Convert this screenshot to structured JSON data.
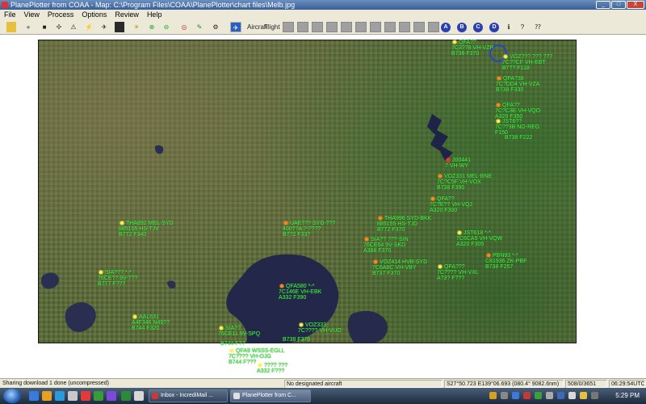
{
  "window": {
    "title": "PlanePlotter from COAA - Map: C:\\Program Files\\COAA\\PlanePlotter\\chart files\\Melb.jpg",
    "minimize": "_",
    "maximize": "□",
    "close": "X"
  },
  "menu": [
    "File",
    "View",
    "Process",
    "Options",
    "Review",
    "Help"
  ],
  "toolbar": {
    "aircraft_label": "Aircraft",
    "flight_label": "Flight",
    "letters": [
      "A",
      "B",
      "C",
      "D"
    ]
  },
  "aircraft": [
    {
      "id": "a1",
      "lines": [
        "QFA??",
        "7C3??8 VH-VZP",
        "B738 F370"
      ],
      "color": "yellow"
    },
    {
      "id": "a2",
      "lines": [
        "VOZ??? ??? ???",
        "7C??CF VH-EBT",
        "B7?? F118"
      ],
      "color": "yellow"
    },
    {
      "id": "a3",
      "lines": [
        "QFA?38",
        "7C?DD4 VH-VZA",
        "B738 F330"
      ],
      "color": "orange"
    },
    {
      "id": "a4",
      "lines": [
        "QFA??",
        "7C?C3E VH-VQO",
        "A320 F350"
      ],
      "color": "orange"
    },
    {
      "id": "a5",
      "lines": [
        "JST6??",
        "7C??3B NO-REG",
        "F150"
      ],
      "color": "yellow"
    },
    {
      "id": "a6",
      "lines": [
        "B738 F222"
      ],
      "color": "yellow"
    },
    {
      "id": "a7",
      "lines": [
        "J00441",
        "7 VH-WY"
      ],
      "color": "red"
    },
    {
      "id": "a8",
      "lines": [
        "VOZ331 MEL-BNE",
        "7C?C5F VH-VOX",
        "B738 F390"
      ],
      "color": "orange"
    },
    {
      "id": "a9",
      "lines": [
        "QFA??",
        "7C?E?? VH-VQJ",
        "A320 F300"
      ],
      "color": "orange"
    },
    {
      "id": "a10",
      "lines": [
        "JST618 *-*",
        "7C6CA9 VH-VQW",
        "A320 F305"
      ],
      "color": "yellow"
    },
    {
      "id": "a11",
      "lines": [
        "PBN93 *-*",
        "C81936 ZK-PBF",
        "B738 F257"
      ],
      "color": "orange"
    },
    {
      "id": "a12",
      "lines": [
        "THA892 MEL-SYD",
        "885155 HS-TJV",
        "B772 F340"
      ],
      "color": "yellow"
    },
    {
      "id": "a13",
      "lines": [
        "UAE??? SYD-???",
        "400??A ?-????",
        "B772 F33?"
      ],
      "color": "orange"
    },
    {
      "id": "a14",
      "lines": [
        "THA996 SYD-BKK",
        "885155 HS-TJD",
        "B772 F370"
      ],
      "color": "orange"
    },
    {
      "id": "a15",
      "lines": [
        "SIA?? ???-SIN",
        "76CE64 9V-SKD",
        "A388 F370"
      ],
      "color": "orange"
    },
    {
      "id": "a16",
      "lines": [
        "VOZ414 HVB-SYD",
        "7C6A8C VH-VBY",
        "B737 F370"
      ],
      "color": "orange"
    },
    {
      "id": "a17",
      "lines": [
        "QFA???",
        "7C???? VH-VXL",
        "A?3? F???"
      ],
      "color": "yellow"
    },
    {
      "id": "a18",
      "lines": [
        "QFA580 *-*",
        "7C146E VH-EBK",
        "A332 F390"
      ],
      "color": "orange"
    },
    {
      "id": "a19",
      "lines": [
        "SIA??? *-*",
        "76CE?? 9V-???",
        "B777 F???"
      ],
      "color": "yellow"
    },
    {
      "id": "a20",
      "lines": [
        "AAL631",
        "A4F346 N49??",
        "B744 F320"
      ],
      "color": "yellow"
    },
    {
      "id": "a21",
      "lines": [
        "SIA??",
        "76CE11 9V-SPQ",
        "B744 F??"
      ],
      "color": "yellow"
    },
    {
      "id": "a22",
      "lines": [
        "VOZ333",
        "7C???? VH-VUO",
        "B738 F370"
      ],
      "color": "yellow"
    },
    {
      "id": "a23",
      "lines": [
        "QFA9 WSSS-EGLL",
        "7C???? VH-OJG",
        "B744 F???"
      ],
      "color": "yellow"
    },
    {
      "id": "a24",
      "lines": [
        "???? ???",
        "A332 F???"
      ],
      "color": "yellow"
    }
  ],
  "status": {
    "message": "Sharing download 1 done (uncompressed)",
    "designated": "No designated aircraft",
    "coords": "S27°50.723 E139°06.693 (080.4° 9082.6nm)",
    "count": "508/0/3651",
    "utc": "06:29:54UTC"
  },
  "taskbar": {
    "tasks": [
      "Inbox - IncrediMail ...",
      "PlanePlotter from C..."
    ],
    "clock": "5:29 PM"
  }
}
